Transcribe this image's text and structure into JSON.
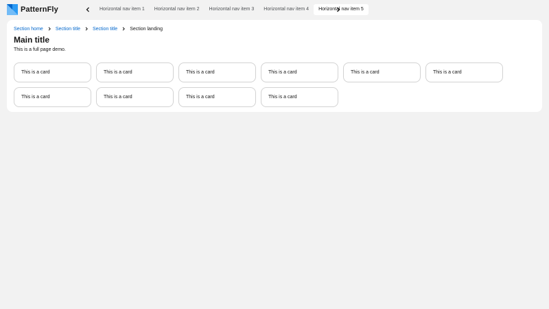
{
  "brand": {
    "name": "PatternFly",
    "logo_icon": "patternfly-logo-icon"
  },
  "colors": {
    "accent": "#0066cc",
    "page_bg": "#f2f2f2",
    "card_border": "#d2d2d2"
  },
  "nav": {
    "items": [
      {
        "label": "Horizontal nav item 1",
        "current": false
      },
      {
        "label": "Horizontal nav item 2",
        "current": false
      },
      {
        "label": "Horizontal nav item 3",
        "current": false
      },
      {
        "label": "Horizontal nav item 4",
        "current": false
      },
      {
        "label": "Horizontal nav item 5",
        "current": true
      }
    ]
  },
  "breadcrumb": {
    "items": [
      "Section home",
      "Section title",
      "Section title"
    ],
    "current": "Section landing"
  },
  "main": {
    "title": "Main title",
    "subtitle": "This is a full page demo."
  },
  "cards": [
    "This is a card",
    "This is a card",
    "This is a card",
    "This is a card",
    "This is a card",
    "This is a card",
    "This is a card",
    "This is a card",
    "This is a card",
    "This is a card"
  ]
}
